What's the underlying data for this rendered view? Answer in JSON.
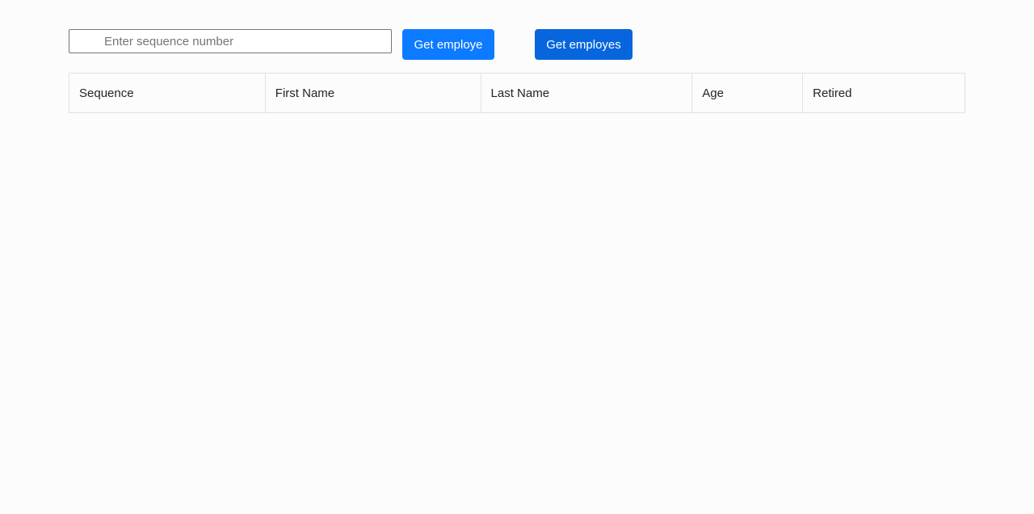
{
  "search": {
    "placeholder": "Enter sequence number",
    "value": ""
  },
  "buttons": {
    "get_one_label": "Get employe",
    "get_all_label": "Get employes"
  },
  "table": {
    "headers": [
      "Sequence",
      "First Name",
      "Last Name",
      "Age",
      "Retired"
    ],
    "rows": []
  },
  "colors": {
    "primary_button": "#0d7bff",
    "primary_button_active": "#0766dd",
    "border": "#dee2e6",
    "background": "#fcfcfd"
  }
}
